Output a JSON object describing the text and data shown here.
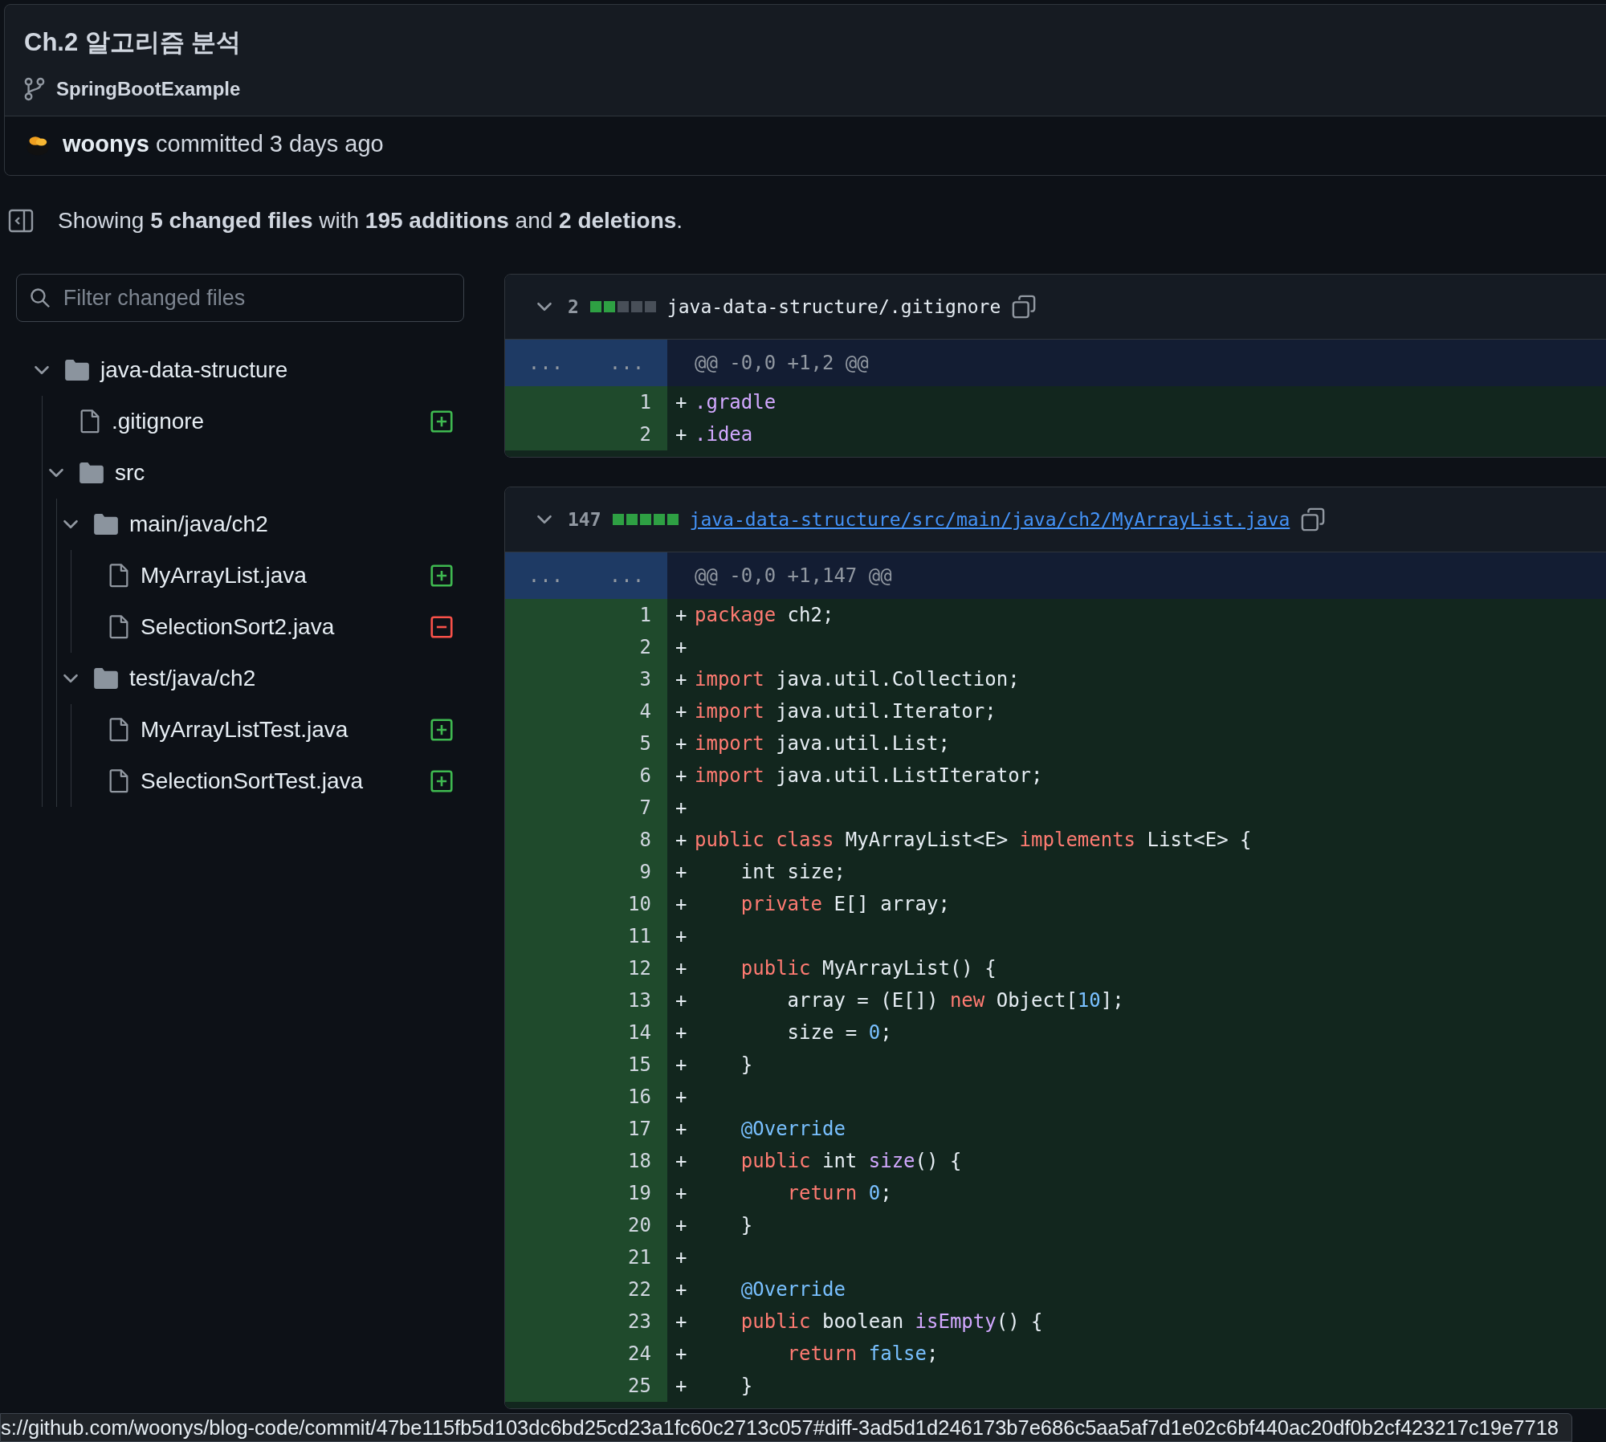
{
  "commit": {
    "title": "Ch.2 알고리즘 분석",
    "branch": "SpringBootExample",
    "byline": "**woonys** committed 3 days ago"
  },
  "summary": "Showing **5 changed files** with **195 additions** and **2 deletions**.",
  "filter": {
    "placeholder": "Filter changed files"
  },
  "tree": [
    {
      "kind": "folder",
      "name": "java-data-structure",
      "expanded": true,
      "children": [
        {
          "kind": "file",
          "name": ".gitignore",
          "deleted": false
        },
        {
          "kind": "folder",
          "name": "src",
          "expanded": true,
          "children": [
            {
              "kind": "folder",
              "name": "main/java/ch2",
              "expanded": true,
              "children": [
                {
                  "kind": "file",
                  "name": "MyArrayList.java",
                  "deleted": false
                },
                {
                  "kind": "file",
                  "name": "SelectionSort2.java",
                  "deleted": true
                }
              ]
            },
            {
              "kind": "folder",
              "name": "test/java/ch2",
              "expanded": true,
              "children": [
                {
                  "kind": "file",
                  "name": "MyArrayListTest.java",
                  "deleted": false
                },
                {
                  "kind": "file",
                  "name": "SelectionSortTest.java",
                  "deleted": false
                }
              ]
            }
          ]
        }
      ]
    }
  ],
  "diffs": [
    {
      "expanded": true,
      "count": "2",
      "level": 0.4,
      "path": "java-data-structure/.gitignore",
      "link": false,
      "hunk_left": "...",
      "hunk_right": "...",
      "hunk": "@@ -0,0 +1,2 @@",
      "lines": [
        {
          "number": "1",
          "sign": "+",
          "tokens": [
            {
              "text": ".gradle",
              "kind": "function"
            }
          ]
        },
        {
          "number": "2",
          "sign": "+",
          "tokens": [
            {
              "text": ".idea",
              "kind": "function"
            }
          ]
        }
      ]
    },
    {
      "expanded": true,
      "count": "147",
      "level": 1,
      "path": "java-data-structure/src/main/java/ch2/MyArrayList.java",
      "link": true,
      "hunk_left": "...",
      "hunk_right": "...",
      "hunk": "@@ -0,0 +1,147 @@",
      "lines": [
        {
          "number": "1",
          "sign": "+",
          "tokens": [
            {
              "text": "package",
              "kind": "keyword"
            },
            {
              "text": " ch2;",
              "kind": "plain"
            }
          ]
        },
        {
          "number": "2",
          "sign": "+"
        },
        {
          "number": "3",
          "sign": "+",
          "tokens": [
            {
              "text": "import",
              "kind": "keyword"
            },
            {
              "text": " java.util.Collection;",
              "kind": "plain"
            }
          ]
        },
        {
          "number": "4",
          "sign": "+",
          "tokens": [
            {
              "text": "import",
              "kind": "keyword"
            },
            {
              "text": " java.util.Iterator;",
              "kind": "plain"
            }
          ]
        },
        {
          "number": "5",
          "sign": "+",
          "tokens": [
            {
              "text": "import",
              "kind": "keyword"
            },
            {
              "text": " java.util.List;",
              "kind": "plain"
            }
          ]
        },
        {
          "number": "6",
          "sign": "+",
          "tokens": [
            {
              "text": "import",
              "kind": "keyword"
            },
            {
              "text": " java.util.ListIterator;",
              "kind": "plain"
            }
          ]
        },
        {
          "number": "7",
          "sign": "+"
        },
        {
          "number": "8",
          "sign": "+",
          "tokens": [
            {
              "text": "public class",
              "kind": "keyword"
            },
            {
              "text": " MyArrayList<E> ",
              "kind": "plain"
            },
            {
              "text": "implements",
              "kind": "keyword"
            },
            {
              "text": " List<E> {",
              "kind": "plain"
            }
          ]
        },
        {
          "number": "9",
          "sign": "+",
          "tokens": [
            {
              "text": "    int size;",
              "kind": "plain"
            }
          ]
        },
        {
          "number": "10",
          "sign": "+",
          "tokens": [
            {
              "text": "    private",
              "kind": "keyword"
            },
            {
              "text": " E[] array;",
              "kind": "plain"
            }
          ]
        },
        {
          "number": "11",
          "sign": "+"
        },
        {
          "number": "12",
          "sign": "+",
          "tokens": [
            {
              "text": "    public",
              "kind": "keyword"
            },
            {
              "text": " MyArrayList() {",
              "kind": "plain"
            }
          ]
        },
        {
          "number": "13",
          "sign": "+",
          "tokens": [
            {
              "text": "        array = (E[]) ",
              "kind": "plain"
            },
            {
              "text": "new",
              "kind": "keyword"
            },
            {
              "text": " Object[",
              "kind": "plain"
            },
            {
              "text": "10",
              "kind": "constant"
            },
            {
              "text": "];",
              "kind": "plain"
            }
          ]
        },
        {
          "number": "14",
          "sign": "+",
          "tokens": [
            {
              "text": "        size = ",
              "kind": "plain"
            },
            {
              "text": "0",
              "kind": "constant"
            },
            {
              "text": ";",
              "kind": "plain"
            }
          ]
        },
        {
          "number": "15",
          "sign": "+",
          "tokens": [
            {
              "text": "    }",
              "kind": "plain"
            }
          ]
        },
        {
          "number": "16",
          "sign": "+"
        },
        {
          "number": "17",
          "sign": "+",
          "tokens": [
            {
              "text": "    @Override",
              "kind": "constant"
            }
          ]
        },
        {
          "number": "18",
          "sign": "+",
          "tokens": [
            {
              "text": "    public",
              "kind": "keyword"
            },
            {
              "text": " int ",
              "kind": "plain"
            },
            {
              "text": "size",
              "kind": "function"
            },
            {
              "text": "() {",
              "kind": "plain"
            }
          ]
        },
        {
          "number": "19",
          "sign": "+",
          "tokens": [
            {
              "text": "        return",
              "kind": "keyword"
            },
            {
              "text": " 0",
              "kind": "constant"
            },
            {
              "text": ";",
              "kind": "plain"
            }
          ]
        },
        {
          "number": "20",
          "sign": "+",
          "tokens": [
            {
              "text": "    }",
              "kind": "plain"
            }
          ]
        },
        {
          "number": "21",
          "sign": "+"
        },
        {
          "number": "22",
          "sign": "+",
          "tokens": [
            {
              "text": "    @Override",
              "kind": "constant"
            }
          ]
        },
        {
          "number": "23",
          "sign": "+",
          "tokens": [
            {
              "text": "    public",
              "kind": "keyword"
            },
            {
              "text": " boolean ",
              "kind": "plain"
            },
            {
              "text": "isEmpty",
              "kind": "function"
            },
            {
              "text": "() {",
              "kind": "plain"
            }
          ]
        },
        {
          "number": "24",
          "sign": "+",
          "tokens": [
            {
              "text": "        return",
              "kind": "keyword"
            },
            {
              "text": " false",
              "kind": "constant"
            },
            {
              "text": ";",
              "kind": "plain"
            }
          ]
        },
        {
          "number": "25",
          "sign": "+",
          "tokens": [
            {
              "text": "    }",
              "kind": "plain"
            }
          ]
        }
      ]
    }
  ],
  "status_url": "s://github.com/woonys/blog-code/commit/47be115fb5d103dc6bd25cd23a1fc60c2713c057#diff-3ad5d1d246173b7e686c5aa5af7d1e02c6bf440ac20df0b2cf423217c19e7718"
}
